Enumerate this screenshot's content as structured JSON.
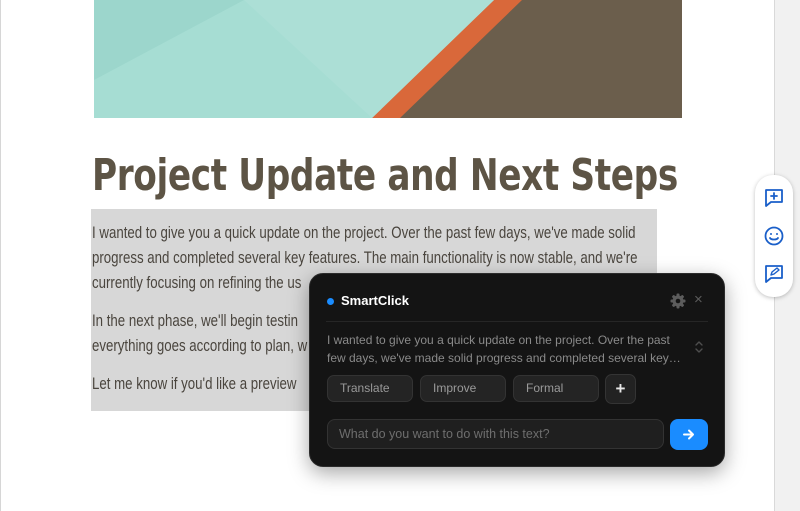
{
  "document": {
    "title": "Project Update and Next Steps",
    "paragraphs": [
      [
        "I wanted to give you a quick update on the project. Over the past few days, we've made solid",
        "progress and completed several key features. The main functionality is now stable, and we're",
        "currently focusing on refining the us"
      ],
      [
        "In the next phase, we'll begin testin",
        "everything goes according to plan, w"
      ],
      [
        "Let me know if you'd like a preview"
      ]
    ]
  },
  "side_toolbar": {
    "items": [
      "add-comment-icon",
      "emoji-icon",
      "suggest-edit-icon"
    ]
  },
  "smartclick": {
    "title": "SmartClick",
    "accent": "#1a8cff",
    "preview_text": "I wanted to give you a quick update on the project. Over the past few days, we've made solid progress and completed several key features.",
    "actions": [
      "Translate",
      "Improve",
      "Formal"
    ],
    "add_label": "+",
    "close_label": "×",
    "prompt_placeholder": "What do you want to do with this text?"
  }
}
